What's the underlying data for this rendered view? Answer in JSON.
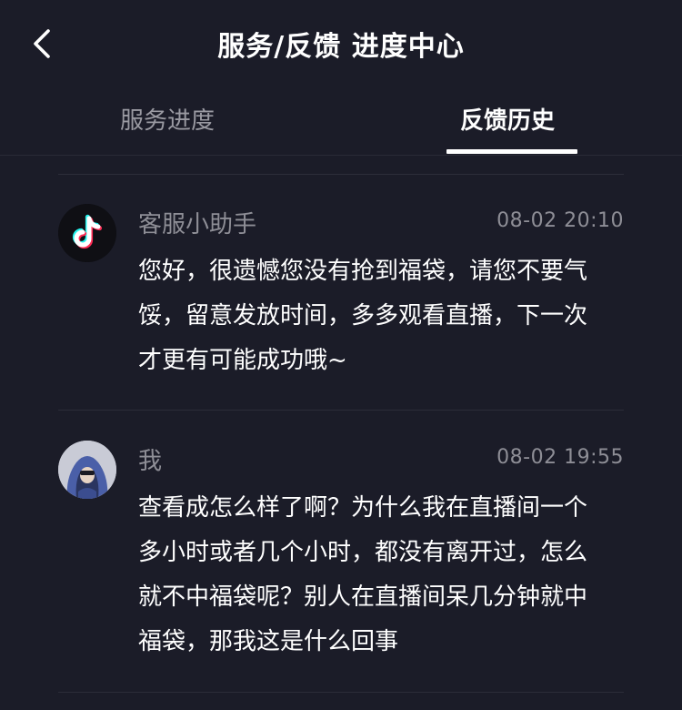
{
  "header": {
    "title": "服务/反馈 进度中心",
    "back_icon": "chevron-left-icon"
  },
  "tabs": [
    {
      "label": "服务进度",
      "active": false
    },
    {
      "label": "反馈历史",
      "active": true
    }
  ],
  "messages": [
    {
      "sender": "客服小助手",
      "time": "08-02 20:10",
      "avatar": "tiktok-logo-icon",
      "text": "您好，很遗憾您没有抢到福袋，请您不要气馁，留意发放时间，多多观看直播，下一次才更有可能成功哦~"
    },
    {
      "sender": "我",
      "time": "08-02 19:55",
      "avatar": "user-avatar-hooded-icon",
      "text": "查看成怎么样了啊？为什么我在直播间一个多小时或者几个小时，都没有离开过，怎么就不中福袋呢？别人在直播间呆几分钟就中福袋，那我这是什么回事"
    }
  ],
  "colors": {
    "background": "#1b1c28",
    "text_primary": "#ffffff",
    "text_secondary": "#8e8e96",
    "divider": "#2c2d39",
    "brand_cyan": "#25f4ee",
    "brand_red": "#fe2c55"
  }
}
